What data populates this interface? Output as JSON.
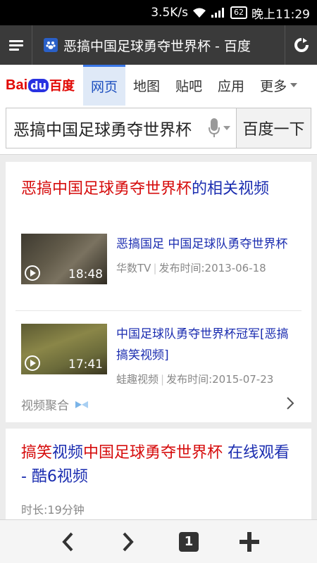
{
  "status_bar": {
    "speed": "3.5K/s",
    "battery": "62",
    "time": "晚上11:29"
  },
  "browser": {
    "page_title": "恶搞中国足球勇夺世界杯 - 百度"
  },
  "baidu_nav": {
    "logo_bai": "Bai",
    "logo_du": "du",
    "logo_cn": "百度",
    "tabs": [
      {
        "label": "网页",
        "active": true
      },
      {
        "label": "地图",
        "active": false
      },
      {
        "label": "贴吧",
        "active": false
      },
      {
        "label": "应用",
        "active": false
      }
    ],
    "more_label": "更多"
  },
  "search": {
    "query": "恶搞中国足球勇夺世界杯",
    "button_label": "百度一下"
  },
  "result1": {
    "title_red": "恶搞中国足球勇夺世界杯",
    "title_blue": "的相关视频",
    "videos": [
      {
        "title": "恶搞国足 中国足球队勇夺世界杯",
        "duration": "18:48",
        "source": "华数TV",
        "date_label": "发布时间:2013-06-18"
      },
      {
        "title": "中国足球队勇夺世界杯冠军[恶搞搞笑视频]",
        "duration": "17:41",
        "source": "蛙趣视频",
        "date_label": "发布时间:2015-07-23"
      }
    ],
    "aggregate_label": "视频聚合"
  },
  "result2": {
    "title_part1": "搞笑",
    "title_part2": "视频",
    "title_part3": "中国足球勇夺世界杯",
    "title_part4": " 在线观看 - 酷6视频",
    "duration_label": "时长:19分钟"
  },
  "toolbar": {
    "tab_count": "1"
  }
}
